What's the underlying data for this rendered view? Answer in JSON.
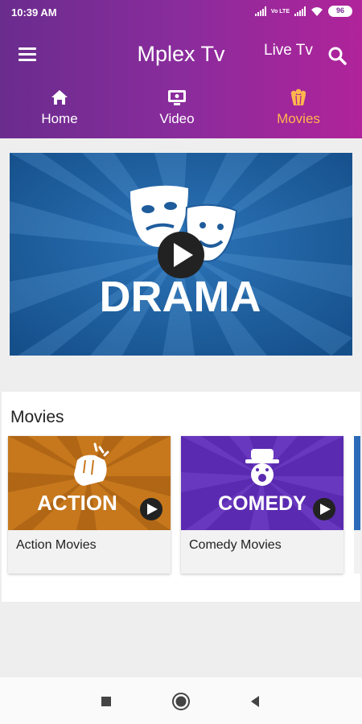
{
  "status_bar": {
    "time": "10:39 AM",
    "network_label": "Vo LTE",
    "battery": "96"
  },
  "app_bar": {
    "title": "Mplex Tv",
    "live_tv": "Live Tv",
    "menu_icon": "hamburger-menu-icon",
    "search_icon": "search-icon"
  },
  "tabs": [
    {
      "label": "Home",
      "icon": "home-icon",
      "active": false
    },
    {
      "label": "Video",
      "icon": "tv-video-icon",
      "active": false
    },
    {
      "label": "Movies",
      "icon": "popcorn-icon",
      "active": true
    }
  ],
  "hero": {
    "title": "DRAMA",
    "icon": "drama-masks-icon",
    "play_icon": "play-icon"
  },
  "movies_section": {
    "title": "Movies",
    "items": [
      {
        "thumb_text": "ACTION",
        "label": "Action Movies",
        "icon": "fist-icon",
        "color": "#c7781c"
      },
      {
        "thumb_text": "COMEDY",
        "label": "Comedy Movies",
        "icon": "clown-icon",
        "color": "#5a2ab0"
      }
    ]
  },
  "colors": {
    "header_start": "#6a2c8e",
    "header_end": "#b0239a",
    "active_tab": "#ffb74d",
    "hero_blue": "#1f5c9c"
  },
  "nav_bar": {
    "icons": [
      "recents-square-icon",
      "home-circle-icon",
      "back-triangle-icon"
    ]
  }
}
